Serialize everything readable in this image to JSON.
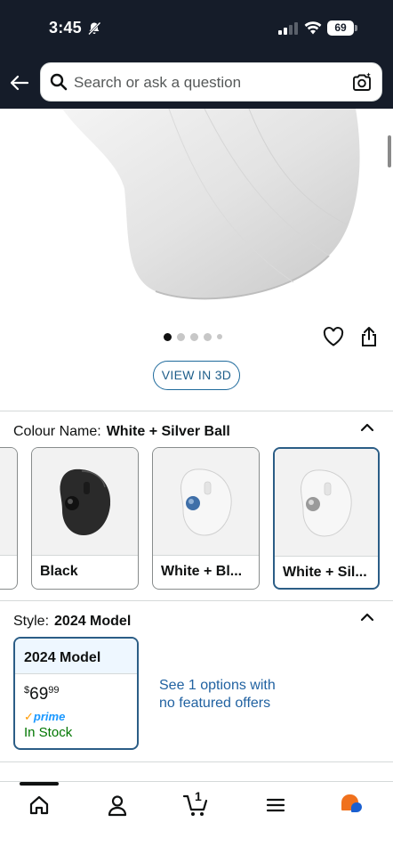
{
  "status_bar": {
    "time": "3:45",
    "battery": "69"
  },
  "header": {
    "search_placeholder": "Search or ask a question"
  },
  "gallery": {
    "view_3d_label": "VIEW IN 3D",
    "dots": 5,
    "active_dot": 0
  },
  "colour": {
    "label": "Colour Name:",
    "selected_value": "White + Silver Ball",
    "options": [
      {
        "label": "Black",
        "selected": false
      },
      {
        "label": "White + Bl...",
        "selected": false
      },
      {
        "label": "White + Sil...",
        "selected": true
      }
    ]
  },
  "style": {
    "label": "Style:",
    "selected_value": "2024 Model",
    "card": {
      "title": "2024 Model",
      "price_currency": "$",
      "price_whole": "69",
      "price_fraction": "99",
      "prime": "prime",
      "stock": "In Stock"
    },
    "see_options_text": "See 1 options with no featured offers"
  },
  "tabbar": {
    "cart_count": "1"
  },
  "colors": {
    "header_bg": "#151c29",
    "link": "#2162a1",
    "selected_border": "#2b5d86",
    "in_stock": "#007600",
    "prime": "#1a98ff"
  }
}
